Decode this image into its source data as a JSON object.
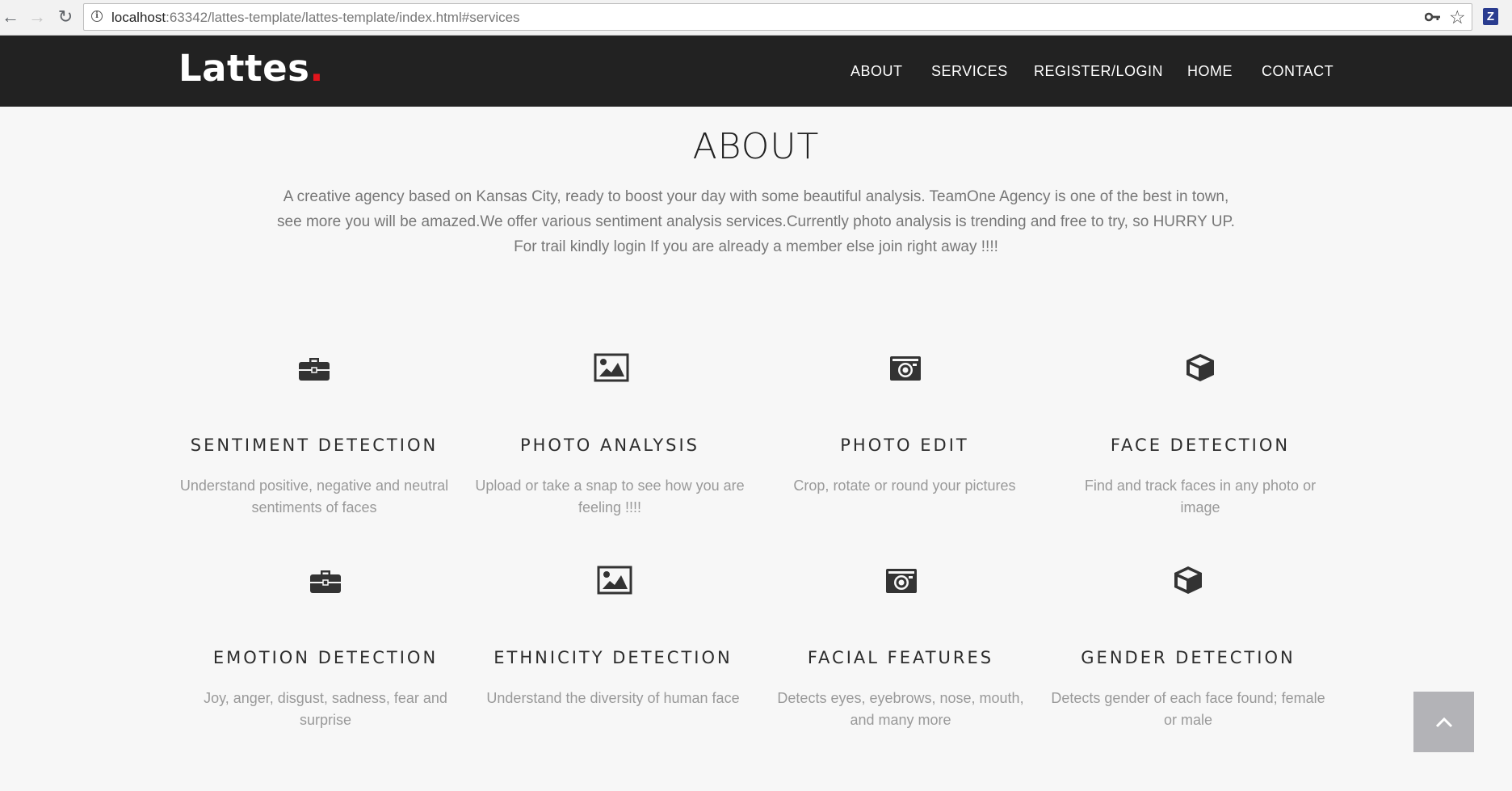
{
  "browser": {
    "url_host": "localhost",
    "url_rest": ":63342/lattes-template/lattes-template/index.html#services",
    "back_icon": "arrow-left-icon",
    "forward_icon": "arrow-right-icon",
    "reload_icon": "reload-icon",
    "extension_label": "Z"
  },
  "navbar": {
    "logo_text": "Lattes",
    "logo_dot": ".",
    "links": [
      {
        "label": "ABOUT"
      },
      {
        "label": "SERVICES"
      },
      {
        "label": "REGISTER/LOGIN"
      },
      {
        "label": "HOME"
      },
      {
        "label": "CONTACT"
      }
    ]
  },
  "about": {
    "title": "ABOUT",
    "text": "A creative agency based on Kansas City, ready to boost your day with some beautiful analysis. TeamOne Agency is one of the best in town, see more you will be amazed.We offer various sentiment analysis services.Currently photo analysis is trending and free to try, so HURRY UP. For trail kindly login If you are already a member else join right away !!!!"
  },
  "services": [
    {
      "icon": "briefcase-icon",
      "title": "SENTIMENT DETECTION",
      "desc": "Understand positive, negative and neutral sentiments of faces"
    },
    {
      "icon": "image-icon",
      "title": "PHOTO ANALYSIS",
      "desc": "Upload or take a snap to see how you are feeling !!!!"
    },
    {
      "icon": "camera-icon",
      "title": "PHOTO EDIT",
      "desc": "Crop, rotate or round your pictures"
    },
    {
      "icon": "cube-icon",
      "title": "FACE DETECTION",
      "desc": "Find and track faces in any photo or image"
    },
    {
      "icon": "briefcase-icon",
      "title": "EMOTION DETECTION",
      "desc": "Joy, anger, disgust, sadness, fear and surprise"
    },
    {
      "icon": "image-icon",
      "title": "ETHNICITY DETECTION",
      "desc": "Understand the diversity of human face"
    },
    {
      "icon": "camera-icon",
      "title": "FACIAL FEATURES",
      "desc": "Detects eyes, eyebrows, nose, mouth, and many more"
    },
    {
      "icon": "cube-icon",
      "title": "GENDER DETECTION",
      "desc": "Detects gender of each face found; female or male"
    }
  ],
  "back_to_top": {
    "icon": "chevron-up-icon"
  },
  "colors": {
    "navbar_bg": "#222222",
    "logo_dot": "#e2141c",
    "page_bg": "#f7f7f7",
    "back_to_top_bg": "#b3b3b7"
  }
}
